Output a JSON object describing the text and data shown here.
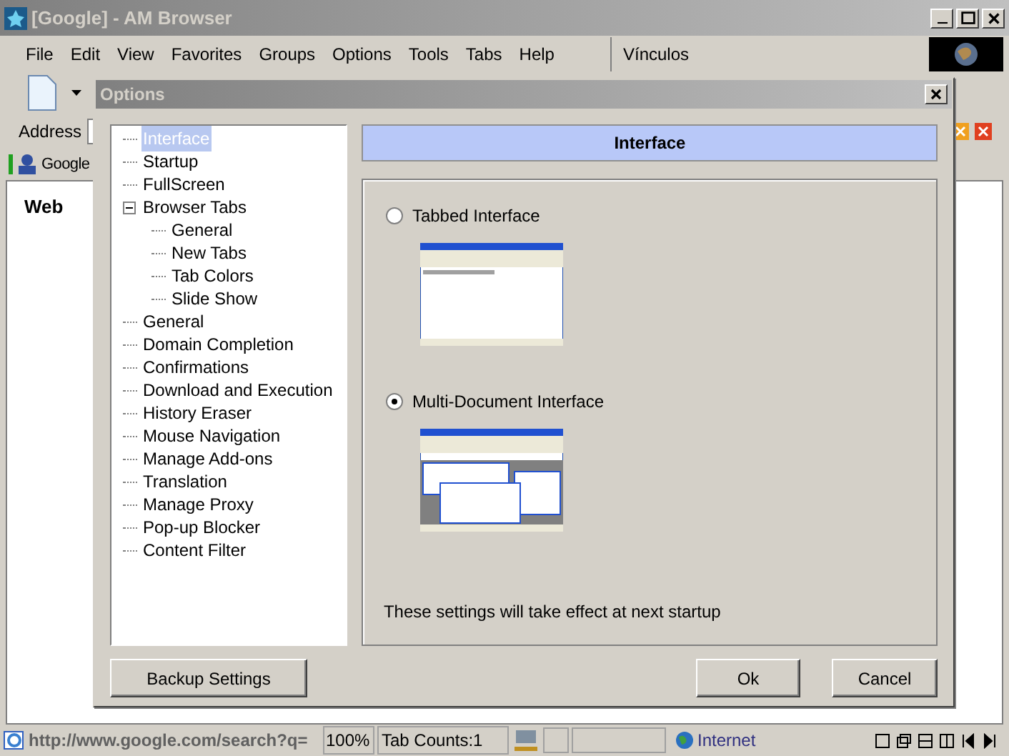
{
  "window": {
    "title": "[Google] - AM Browser"
  },
  "menu": [
    "File",
    "Edit",
    "View",
    "Favorites",
    "Groups",
    "Options",
    "Tools",
    "Tabs",
    "Help"
  ],
  "links_label": "Vínculos",
  "address_label": "Address",
  "links_bar": {
    "item": "Google"
  },
  "search_tab": "Web",
  "dialog": {
    "title": "Options",
    "tree": [
      {
        "label": "Interface",
        "selected": true
      },
      {
        "label": "Startup",
        "selected": false
      },
      {
        "label": "FullScreen",
        "selected": false
      },
      {
        "label": "Browser Tabs",
        "selected": false,
        "expanded": true,
        "children": [
          {
            "label": "General",
            "selected": false
          },
          {
            "label": "New Tabs",
            "selected": false
          },
          {
            "label": "Tab Colors",
            "selected": false
          },
          {
            "label": "Slide Show",
            "selected": false
          }
        ]
      },
      {
        "label": "General",
        "selected": false
      },
      {
        "label": "Domain Completion",
        "selected": false
      },
      {
        "label": "Confirmations",
        "selected": false
      },
      {
        "label": "Download and Execution",
        "selected": false
      },
      {
        "label": "History Eraser",
        "selected": false
      },
      {
        "label": "Mouse Navigation",
        "selected": false
      },
      {
        "label": "Manage Add-ons",
        "selected": false
      },
      {
        "label": "Translation",
        "selected": false
      },
      {
        "label": "Manage Proxy",
        "selected": false
      },
      {
        "label": "Pop-up Blocker",
        "selected": false
      },
      {
        "label": "Content Filter",
        "selected": false
      }
    ],
    "header": "Interface",
    "options": [
      {
        "label": "Tabbed Interface",
        "selected": false,
        "kind": "tabbed"
      },
      {
        "label": "Multi-Document Interface",
        "selected": true,
        "kind": "mdi"
      }
    ],
    "note": "These settings will take effect at next startup",
    "buttons": {
      "backup": "Backup Settings",
      "ok": "Ok",
      "cancel": "Cancel"
    }
  },
  "status_bar": {
    "url": "http://www.google.com/search?q=",
    "zoom": "100%",
    "tabs": "Tab Counts:1",
    "zone": "Internet"
  }
}
